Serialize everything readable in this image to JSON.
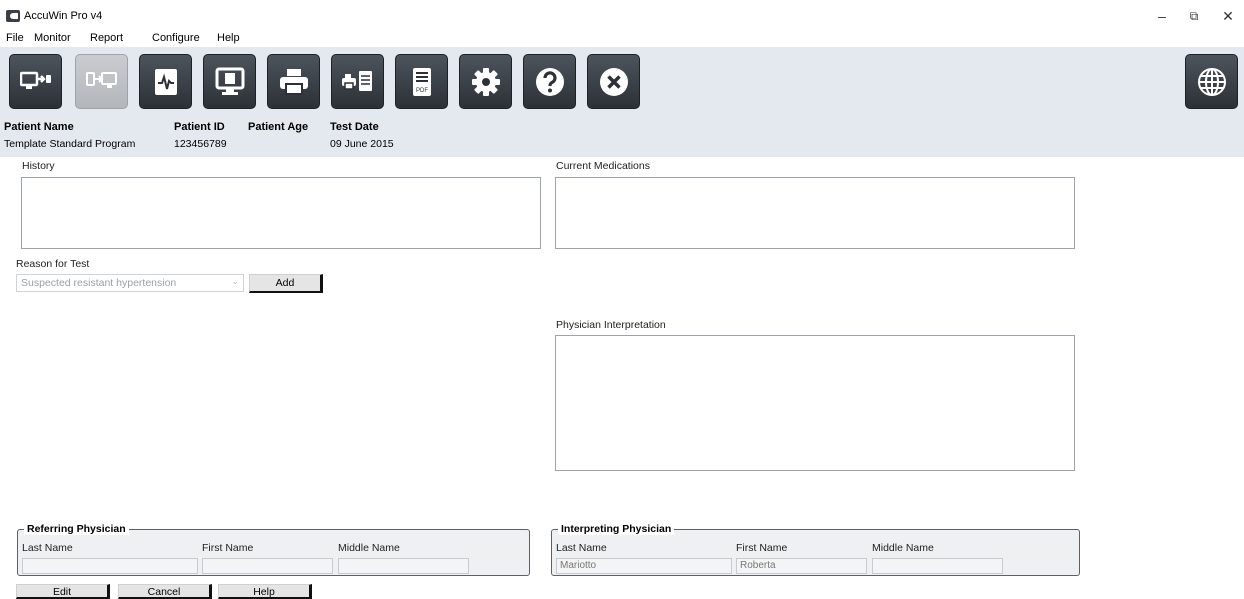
{
  "window": {
    "title": "AccuWin Pro v4"
  },
  "menu": [
    "File",
    "Monitor",
    "Report",
    "Configure",
    "Help"
  ],
  "toolbar": {
    "buttons": [
      {
        "name": "send-to-monitor-icon",
        "enabled": true
      },
      {
        "name": "receive-from-monitor-icon",
        "enabled": false
      },
      {
        "name": "waveform-report-icon",
        "enabled": true
      },
      {
        "name": "monitor-display-icon",
        "enabled": true
      },
      {
        "name": "print-icon",
        "enabled": true
      },
      {
        "name": "print-report-icon",
        "enabled": true
      },
      {
        "name": "pdf-icon",
        "enabled": true
      },
      {
        "name": "gear-icon",
        "enabled": true
      },
      {
        "name": "help-icon",
        "enabled": true
      },
      {
        "name": "close-icon",
        "enabled": true
      }
    ],
    "language_button": "globe-icon"
  },
  "patient": {
    "name_label": "Patient Name",
    "name_value": "Template Standard Program",
    "id_label": "Patient ID",
    "id_value": "123456789",
    "age_label": "Patient Age",
    "age_value": "",
    "date_label": "Test Date",
    "date_value": "09 June 2015"
  },
  "form": {
    "history_label": "History",
    "history_value": "",
    "medications_label": "Current Medications",
    "medications_value": "",
    "reason_label": "Reason for Test",
    "reason_value": "Suspected resistant hypertension",
    "add_button": "Add",
    "interpretation_label": "Physician Interpretation",
    "interpretation_value": ""
  },
  "referring": {
    "title": "Referring Physician",
    "last_label": "Last Name",
    "first_label": "First Name",
    "middle_label": "Middle Name",
    "last_value": "",
    "first_value": "",
    "middle_value": ""
  },
  "interpreting": {
    "title": "Interpreting Physician",
    "last_label": "Last Name",
    "first_label": "First Name",
    "middle_label": "Middle Name",
    "last_value": "Mariotto",
    "first_value": "Roberta",
    "middle_value": ""
  },
  "actions": {
    "edit": "Edit",
    "cancel": "Cancel",
    "help": "Help"
  },
  "colors": {
    "toolbar_bg": "#e4e8ef",
    "button_dark": "#3a4047",
    "button_disabled": "#bfc3c8"
  }
}
